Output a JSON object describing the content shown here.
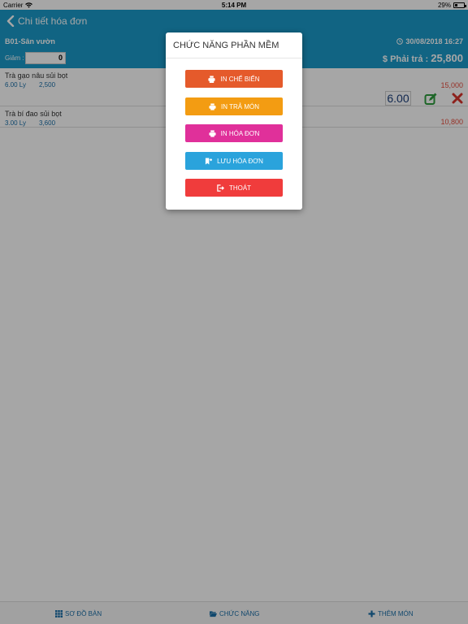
{
  "status_bar": {
    "carrier": "Carrier",
    "time": "5:14 PM",
    "battery": "29%",
    "battery_level": 0.29
  },
  "nav": {
    "title": "Chi tiết hóa đơn"
  },
  "header": {
    "table_name": "B01-Sân vườn",
    "datetime": "30/08/2018 16:27",
    "discount_label": "Giảm :",
    "discount_value": "0",
    "total_label": "$ Phải trả :",
    "total_value": "25,800"
  },
  "items": [
    {
      "name": "Trà gạo nâu sủi bọt",
      "qty": "6.00 Ly",
      "price": "2,500",
      "total": "15,000",
      "edit_qty": "6.00"
    },
    {
      "name": "Trà bí đao sủi bọt",
      "qty": "3.00 Ly",
      "price": "3,600",
      "total": "10,800"
    }
  ],
  "dialog": {
    "title": "CHỨC NĂNG PHẦN MỀM",
    "buttons": [
      {
        "label": "IN CHẾ BIẾN",
        "color": "#e55a2b"
      },
      {
        "label": "IN TRẢ MÓN",
        "color": "#f39c12"
      },
      {
        "label": "IN HÓA ĐƠN",
        "color": "#e0309a"
      },
      {
        "label": "LƯU HÓA ĐƠN",
        "color": "#2aa3dc"
      },
      {
        "label": "THOÁT",
        "color": "#f03c3c"
      }
    ]
  },
  "tabs": {
    "table_map": "SƠ ĐỒ BÀN",
    "functions": "CHỨC NĂNG",
    "add_item": "THÊM MÓN"
  },
  "colors": {
    "primary": "#1b9ac9",
    "accent_red": "#e74c3c",
    "link_blue": "#1b6fa8"
  }
}
